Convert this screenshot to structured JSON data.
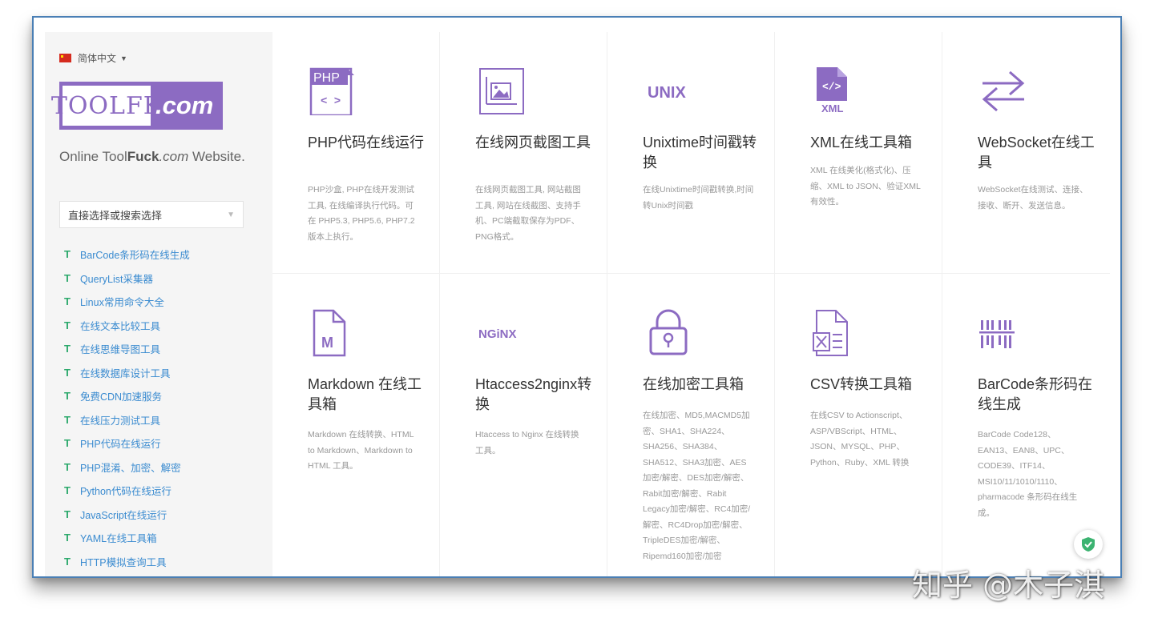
{
  "sidebar": {
    "language": "简体中文",
    "logo_left": "TOOLFK",
    "logo_right": ".com",
    "tagline_a": "Online Tool",
    "tagline_b": "Fuck",
    "tagline_c": ".com",
    "tagline_d": " Website.",
    "search_placeholder": "直接选择或搜索选择",
    "items": [
      {
        "label": "BarCode条形码在线生成"
      },
      {
        "label": "QueryList采集器"
      },
      {
        "label": "Linux常用命令大全"
      },
      {
        "label": "在线文本比较工具"
      },
      {
        "label": "在线思维导图工具"
      },
      {
        "label": "在线数据库设计工具"
      },
      {
        "label": "免费CDN加速服务"
      },
      {
        "label": "在线压力测试工具"
      },
      {
        "label": "PHP代码在线运行"
      },
      {
        "label": "PHP混淆、加密、解密"
      },
      {
        "label": "Python代码在线运行"
      },
      {
        "label": "JavaScript在线运行"
      },
      {
        "label": "YAML在线工具箱"
      },
      {
        "label": "HTTP模拟查询工具"
      }
    ]
  },
  "cards": [
    {
      "icon": "php-code-icon",
      "icon_text": "PHP",
      "title": "PHP代码在线运行",
      "desc": "PHP沙盒, PHP在线开发测试工具, 在线编译执行代码。可在 PHP5.3, PHP5.6, PHP7.2 版本上执行。"
    },
    {
      "icon": "screenshot-icon",
      "title": "在线网页截图工具",
      "desc": "在线网页截图工具, 网站截图工具, 网站在线截图、支持手机、PC端截取保存为PDF、PNG格式。"
    },
    {
      "icon": "unix-icon",
      "icon_text": "UNIX",
      "title": "Unixtime时间戳转换",
      "desc": "在线Unixtime时间戳转换,时间转Unix时间戳"
    },
    {
      "icon": "xml-file-icon",
      "icon_text": "XML",
      "title": "XML在线工具箱",
      "desc": "XML 在线美化(格式化)、压缩、XML to JSON、验证XML有效性。"
    },
    {
      "icon": "websocket-arrows-icon",
      "title": "WebSocket在线工具",
      "desc": "WebSocket在线测试、连接、接收、断开、发送信息。"
    },
    {
      "icon": "markdown-file-icon",
      "icon_text": "M",
      "title": "Markdown 在线工具箱",
      "desc": "Markdown 在线转换、HTML to Markdown、Markdown to HTML 工具。"
    },
    {
      "icon": "nginx-icon",
      "icon_text": "NGiNX",
      "title": "Htaccess2nginx转换",
      "desc": "Htaccess to Nginx 在线转换工具。"
    },
    {
      "icon": "lock-icon",
      "title": "在线加密工具箱",
      "desc": "在线加密、MD5,MACMD5加密、SHA1、SHA224、SHA256、SHA384、SHA512、SHA3加密、AES加密/解密、DES加密/解密、Rabit加密/解密、Rabit Legacy加密/解密、RC4加密/解密、RC4Drop加密/解密、TripleDES加密/解密、Ripemd160加密/加密"
    },
    {
      "icon": "csv-file-icon",
      "title": "CSV转换工具箱",
      "desc": "在线CSV to Actionscript、ASP/VBScript、HTML、JSON、MYSQL、PHP、Python、Ruby、XML 转换"
    },
    {
      "icon": "barcode-icon",
      "title": "BarCode条形码在线生成",
      "desc": "BarCode Code128、EAN13、EAN8、UPC、CODE39、ITF14、MSI10/11/1010/1110、pharmacode 条形码在线生成。"
    }
  ],
  "watermark": "知乎 @木子淇",
  "colors": {
    "accent": "#8c6bc2",
    "link": "#3a8bd0",
    "tmark": "#2aa86a",
    "shield": "#3cb371"
  }
}
